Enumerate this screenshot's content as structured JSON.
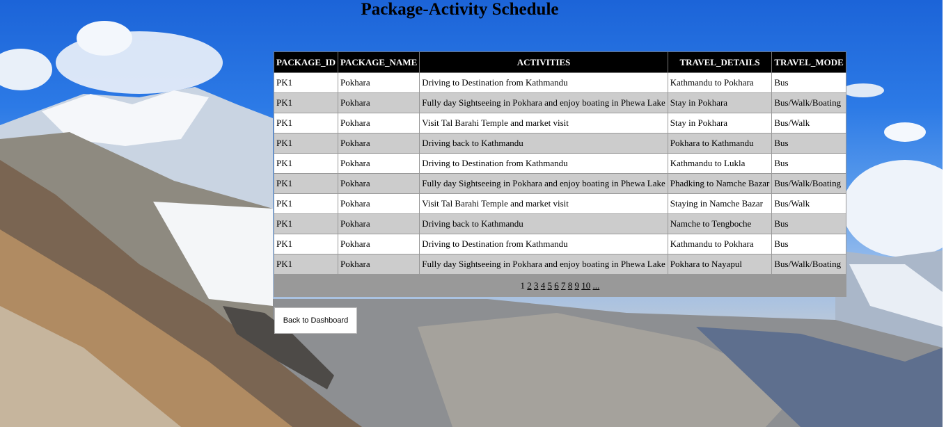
{
  "page": {
    "title": "Package-Activity Schedule"
  },
  "table": {
    "columns": [
      "PACKAGE_ID",
      "PACKAGE_NAME",
      "ACTIVITIES",
      "TRAVEL_DETAILS",
      "TRAVEL_MODE"
    ],
    "rows": [
      [
        "PK1",
        "Pokhara",
        "Driving to Destination from Kathmandu",
        "Kathmandu to Pokhara",
        "Bus"
      ],
      [
        "PK1",
        "Pokhara",
        "Fully day Sightseeing in Pokhara and enjoy boating in Phewa Lake",
        "Stay in Pokhara",
        "Bus/Walk/Boating"
      ],
      [
        "PK1",
        "Pokhara",
        "Visit Tal Barahi Temple and market visit",
        "Stay in Pokhara",
        "Bus/Walk"
      ],
      [
        "PK1",
        "Pokhara",
        "Driving back to Kathmandu",
        "Pokhara to Kathmandu",
        "Bus"
      ],
      [
        "PK1",
        "Pokhara",
        "Driving to Destination from Kathmandu",
        "Kathmandu to Lukla",
        "Bus"
      ],
      [
        "PK1",
        "Pokhara",
        "Fully day Sightseeing in Pokhara and enjoy boating in Phewa Lake",
        "Phadking to Namche Bazar",
        "Bus/Walk/Boating"
      ],
      [
        "PK1",
        "Pokhara",
        "Visit Tal Barahi Temple and market visit",
        "Staying in Namche Bazar",
        "Bus/Walk"
      ],
      [
        "PK1",
        "Pokhara",
        "Driving back to Kathmandu",
        "Namche to Tengboche",
        "Bus"
      ],
      [
        "PK1",
        "Pokhara",
        "Driving to Destination from Kathmandu",
        "Kathmandu to Pokhara",
        "Bus"
      ],
      [
        "PK1",
        "Pokhara",
        "Fully day Sightseeing in Pokhara and enjoy boating in Phewa Lake",
        "Pokhara to Nayapul",
        "Bus/Walk/Boating"
      ]
    ]
  },
  "pager": {
    "current": "1",
    "links": [
      "2",
      "3",
      "4",
      "5",
      "6",
      "7",
      "8",
      "9",
      "10",
      "..."
    ]
  },
  "actions": {
    "back_label": "Back to Dashboard"
  },
  "colors": {
    "header_bg": "#000000",
    "row_alt": "#cccccc",
    "pager_bg": "#999999"
  }
}
